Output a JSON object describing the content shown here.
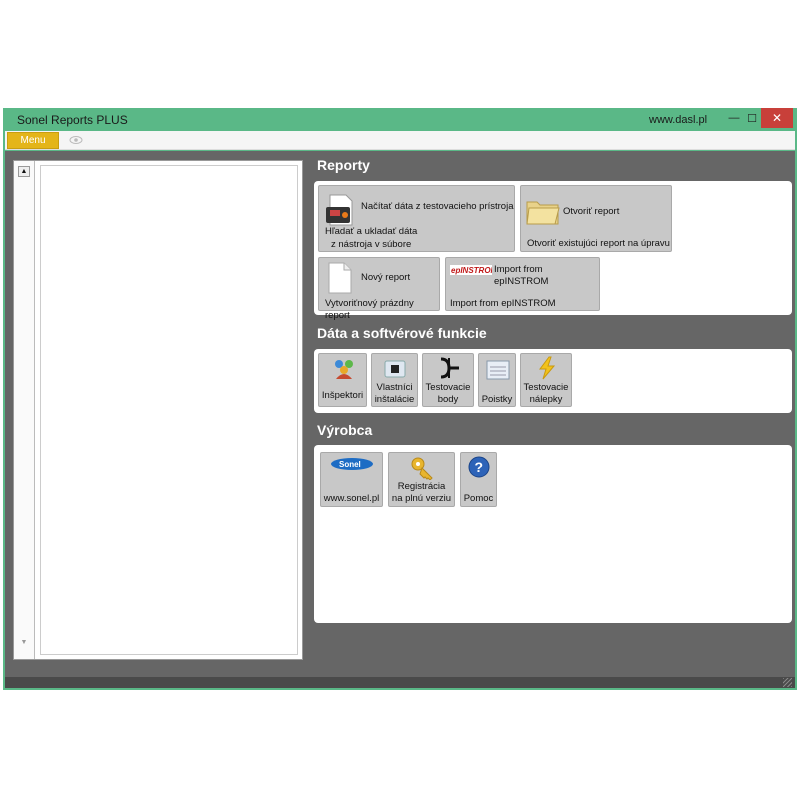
{
  "window": {
    "title": "Sonel Reports PLUS",
    "url": "www.dasl.pl",
    "controls": {
      "minimize": "—",
      "maximize": "☐",
      "close": "✕"
    }
  },
  "menubar": {
    "menu_label": "Menu",
    "view_icon": "eye-icon"
  },
  "tree": {
    "scroll_up": "▲",
    "scroll_down": "▼"
  },
  "sections": {
    "reporty": {
      "title": "Reporty",
      "tiles": {
        "load": {
          "title": "Načítať dáta z testovacieho prístroja",
          "line1": "Hľadať a ukladať dáta",
          "line2": "z nástroja v súbore",
          "icon": "meter-icon"
        },
        "open": {
          "title": "Otvoriť report",
          "desc": "Otvoriť existujúci report na úpravu",
          "icon": "folder-icon"
        },
        "new": {
          "title": "Nový report",
          "desc": "Vytvoriťnový prázdny report",
          "icon": "document-icon"
        },
        "import": {
          "logo": "epINSTROM",
          "title": "Import from epINSTROM",
          "desc": "Import from epINSTROM",
          "icon": "epinstrom-logo-icon"
        }
      }
    },
    "data": {
      "title": "Dáta a softvérové funkcie",
      "tiles": {
        "inspectors": {
          "line1": "Inšpektori",
          "icon": "users-icon"
        },
        "installations": {
          "line1": "Vlastníci",
          "line2": "inštalácie",
          "icon": "installation-folder-icon"
        },
        "points": {
          "line1": "Testovacie",
          "line2": "body",
          "icon": "test-point-icon"
        },
        "fuses": {
          "line1": "Poistky",
          "icon": "fuse-icon"
        },
        "labels": {
          "line1": "Testovacie",
          "line2": "nálepky",
          "icon": "lightning-icon"
        }
      }
    },
    "vyrobca": {
      "title": "Výrobca",
      "tiles": {
        "sonel": {
          "logo": "Sonel",
          "line1": "www.sonel.pl",
          "icon": "sonel-logo-icon"
        },
        "registration": {
          "line1": "Registrácia",
          "line2": "na plnú verziu",
          "icon": "key-icon"
        },
        "help": {
          "glyph": "?",
          "line1": "Pomoc",
          "icon": "help-icon"
        }
      }
    }
  },
  "colors": {
    "window_frame": "#5ab887",
    "content_bg": "#666666",
    "menu_button": "#e4b519",
    "close_button": "#c8403a",
    "tile_bg": "#c8c8c8"
  }
}
